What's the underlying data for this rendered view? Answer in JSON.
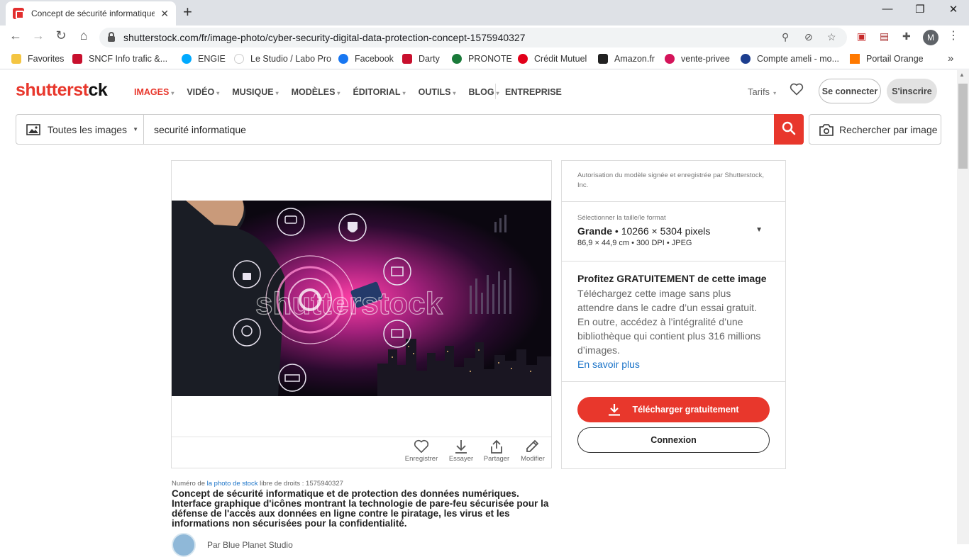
{
  "browser": {
    "tab_title": "Concept de sécurité informatique",
    "url": "shutterstock.com/fr/image-photo/cyber-security-digital-data-protection-concept-1575940327",
    "profile_initial": "M",
    "bookmarks": [
      {
        "label": "Favorites",
        "color": "#f4c542"
      },
      {
        "label": "SNCF Info trafic &...",
        "color": "#c8102e"
      },
      {
        "label": "ENGIE",
        "color": "#00aaff"
      },
      {
        "label": "Le Studio / Labo Pro",
        "color": "#dddddd"
      },
      {
        "label": "Facebook",
        "color": "#1877f2"
      },
      {
        "label": "Darty",
        "color": "#c8102e"
      },
      {
        "label": "PRONOTE",
        "color": "#1a7a3a"
      },
      {
        "label": "Crédit Mutuel",
        "color": "#e2001a"
      },
      {
        "label": "Amazon.fr",
        "color": "#222222"
      },
      {
        "label": "vente-privee",
        "color": "#d4145a"
      },
      {
        "label": "Compte ameli - mo...",
        "color": "#1d3e8f"
      },
      {
        "label": "Portail Orange",
        "color": "#ff7900"
      }
    ]
  },
  "header": {
    "logo_red": "shutterst",
    "logo_dark": "ck",
    "nav": [
      {
        "label": "IMAGES",
        "active": true
      },
      {
        "label": "VIDÉO",
        "active": false
      },
      {
        "label": "MUSIQUE",
        "active": false
      },
      {
        "label": "MODÈLES",
        "active": false
      },
      {
        "label": "ÉDITORIAL",
        "active": false
      },
      {
        "label": "OUTILS",
        "active": false
      },
      {
        "label": "BLOG",
        "active": false
      }
    ],
    "enterprise": "ENTREPRISE",
    "tarifs": "Tarifs",
    "connect": "Se connecter",
    "signup": "S'inscrire"
  },
  "search": {
    "type_label": "Toutes les images",
    "query": "securité informatique",
    "reverse_label": "Rechercher par image"
  },
  "image": {
    "watermark": "shutterstock",
    "actions": [
      {
        "label": "Enregistrer",
        "icon": "heart-icon"
      },
      {
        "label": "Essayer",
        "icon": "download-icon"
      },
      {
        "label": "Partager",
        "icon": "share-icon"
      },
      {
        "label": "Modifier",
        "icon": "edit-icon"
      }
    ]
  },
  "side": {
    "model_release": "Autorisation du modèle signée et enregistrée par Shutterstock, Inc.",
    "format_label": "Sélectionner la taille/le format",
    "format_size": "Grande",
    "format_pixels": " • 10266 × 5304 pixels",
    "format_details": "86,9 × 44,9 cm • 300 DPI • JPEG",
    "promo_title": "Profitez GRATUITEMENT de cette image",
    "promo_line1": "Téléchargez cette image sans plus attendre dans le cadre d’un essai gratuit.",
    "promo_line2": "En outre, accédez à l’intégralité d’une bibliothèque qui contient plus 316 millions d’images.",
    "learn_more": "En savoir plus",
    "download_button": "Télécharger gratuitement",
    "login_button": "Connexion"
  },
  "details": {
    "number_prefix": "Numéro de ",
    "number_link": "la photo de stock",
    "number_suffix": " libre de droits : 1575940327",
    "description": "Concept de sécurité informatique et de protection des données numériques. Interface graphique d'icônes montrant la technologie de pare-feu sécurisée pour la défense de l'accès aux données en ligne contre le piratage, les virus et les informations non sécurisées pour la confidentialité.",
    "author_partial": "Par Blue Planet Studio"
  },
  "colors": {
    "brand": "#e8372c",
    "link": "#1a73c8"
  }
}
